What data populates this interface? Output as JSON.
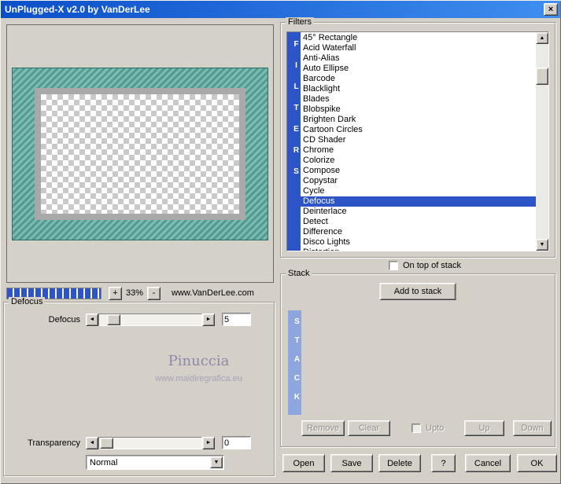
{
  "window": {
    "title": "UnPlugged-X v2.0 by VanDerLee"
  },
  "icons": {
    "close": "×",
    "arrow_left": "◄",
    "arrow_right": "►",
    "arrow_up": "▲",
    "arrow_down": "▼",
    "combo_dropdown": "▼"
  },
  "preview": {
    "zoom_in_label": "+",
    "zoom_out_label": "-",
    "zoom_value": "33%",
    "website": "www.VanDerLee.com"
  },
  "defocus": {
    "group_title": "Defocus",
    "param_label": "Defocus",
    "param_value": "5",
    "transparency_label": "Transparency",
    "transparency_value": "0",
    "blend_mode": "Normal",
    "watermark_name": "Pinuccia",
    "watermark_url": "www.maidiregrafica.eu"
  },
  "filters": {
    "group_title": "Filters",
    "vertical_label": "FILTERS",
    "selected": "Defocus",
    "on_top_label": "On top of stack",
    "items": [
      "45° Rectangle",
      "Acid Waterfall",
      "Anti-Alias",
      "Auto Ellipse",
      "Barcode",
      "Blacklight",
      "Blades",
      "Blobspike",
      "Brighten Dark",
      "Cartoon Circles",
      "CD Shader",
      "Chrome",
      "Colorize",
      "Compose",
      "Copystar",
      "Cycle",
      "Defocus",
      "Deinterlace",
      "Detect",
      "Difference",
      "Disco Lights",
      "Distortion"
    ]
  },
  "stack": {
    "group_title": "Stack",
    "add_button": "Add to stack",
    "vertical_label": "STACK",
    "remove_button": "Remove",
    "clear_button": "Clear",
    "upto_label": "Upto",
    "up_button": "Up",
    "down_button": "Down"
  },
  "footer": {
    "open": "Open",
    "save": "Save",
    "delete": "Delete",
    "help": "?",
    "cancel": "Cancel",
    "ok": "OK"
  },
  "colors": {
    "titlebar": "#1563d2",
    "selection": "#2E55C8",
    "filters_bar": "#2E55C8",
    "stack_bar": "#8EA6DE",
    "progress_fill": "#2E55C8",
    "preview_teal": "#5BA89E",
    "dialog_bg": "#D4D0C8"
  }
}
